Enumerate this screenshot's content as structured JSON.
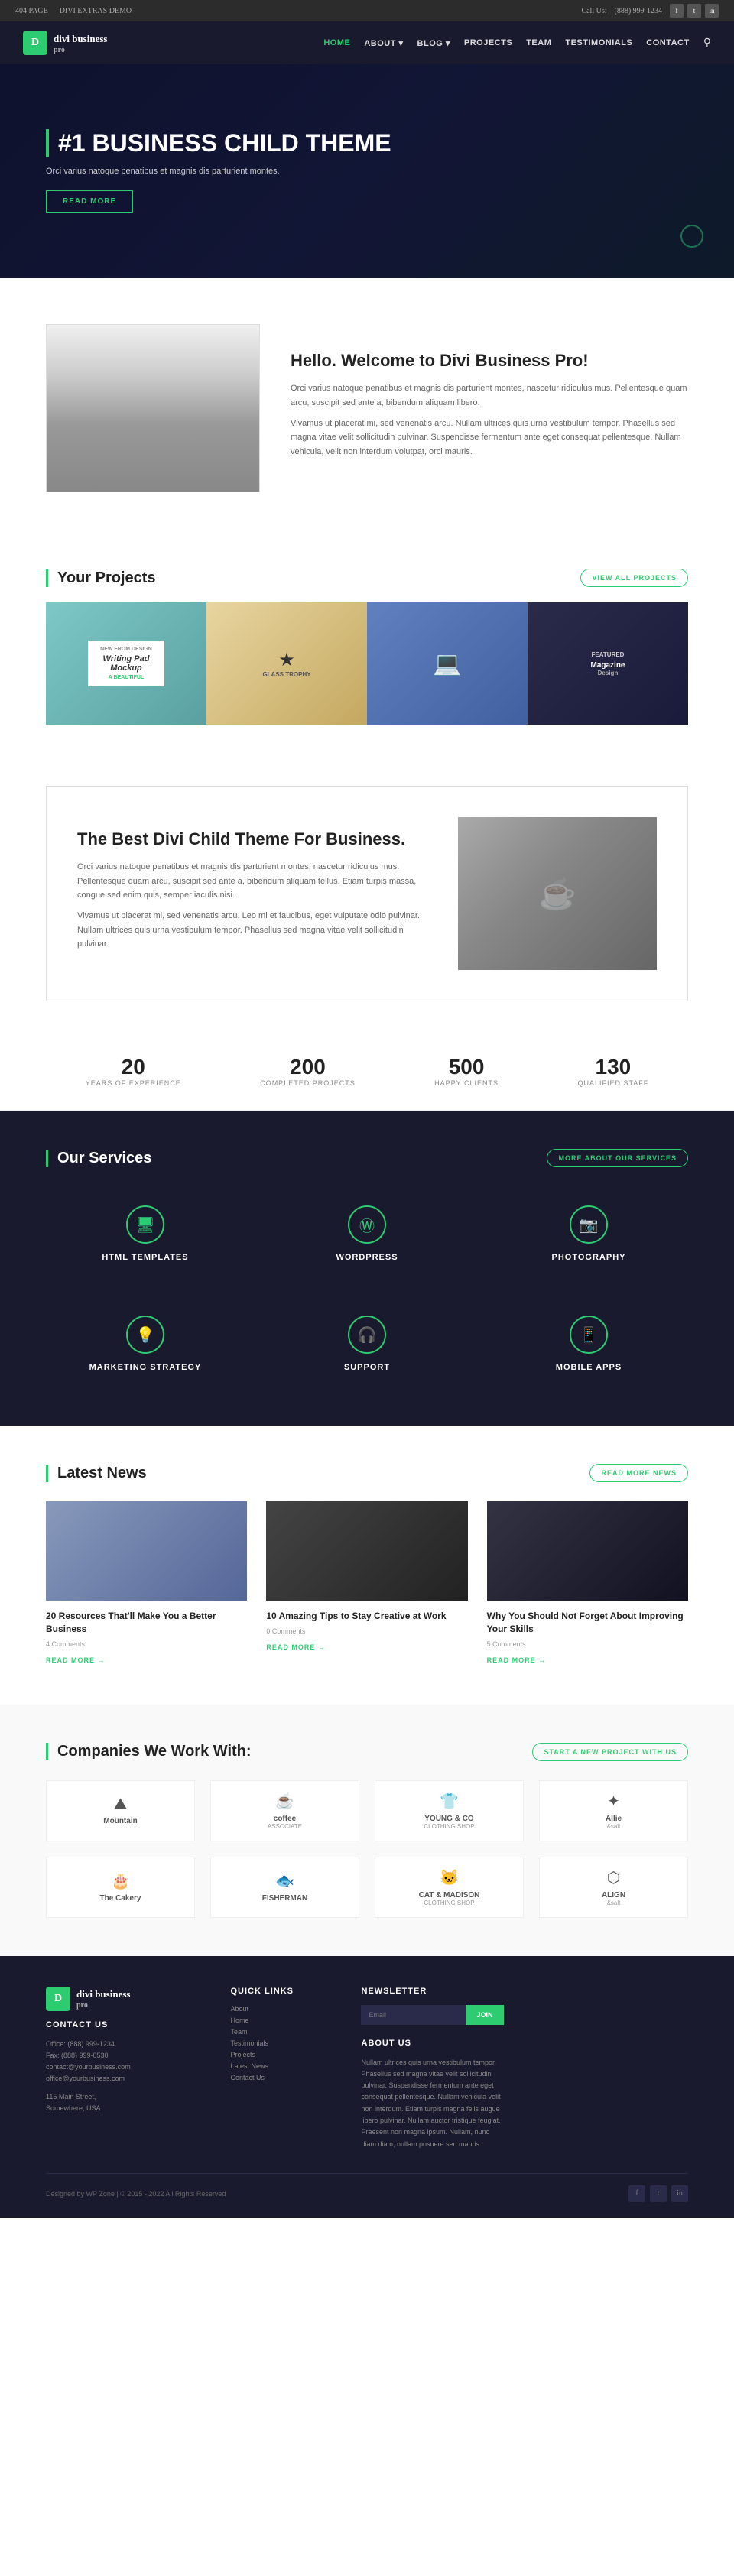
{
  "topbar": {
    "left": {
      "page": "404 PAGE",
      "extras": "DIVI EXTRAS DEMO"
    },
    "right": {
      "phone_label": "Call Us:",
      "phone": "(888) 999-1234"
    },
    "social": [
      "f",
      "t",
      "in"
    ]
  },
  "header": {
    "logo": {
      "icon": "D",
      "name": "divi business",
      "sub": "pro"
    },
    "nav": [
      {
        "label": "HOME",
        "active": true,
        "id": "home"
      },
      {
        "label": "ABOUT ▾",
        "active": false,
        "id": "about"
      },
      {
        "label": "BLOG ▾",
        "active": false,
        "id": "blog"
      },
      {
        "label": "PROJECTS",
        "active": false,
        "id": "projects"
      },
      {
        "label": "TEAM",
        "active": false,
        "id": "team"
      },
      {
        "label": "TESTIMONIALS",
        "active": false,
        "id": "testimonials"
      },
      {
        "label": "CONTACT",
        "active": false,
        "id": "contact"
      }
    ]
  },
  "hero": {
    "title": "#1 BUSINESS CHILD THEME",
    "description": "Orci varius natoque penatibus et magnis dis parturient montes.",
    "cta_label": "Read More"
  },
  "welcome": {
    "title": "Hello. Welcome to Divi Business Pro!",
    "para1": "Orci varius natoque penatibus et magnis dis parturient montes, nascetur ridiculus mus. Pellentesque quam arcu, suscipit sed ante a, bibendum aliquam libero.",
    "para2": "Vivamus ut placerat mi, sed venenatis arcu. Nullam ultrices quis urna vestibulum tempor. Phasellus sed magna vitae velit sollicitudin pulvinar. Suspendisse fermentum ante eget consequat pellentesque. Nullam vehicula, velit non interdum volutpat, orci mauris."
  },
  "projects": {
    "title": "Your Projects",
    "cta_label": "View All Projects",
    "items": [
      {
        "label": "Writing Pad Mockup"
      },
      {
        "label": "Glass Trophy"
      },
      {
        "label": "Laptop Design"
      },
      {
        "label": "Magazine Design"
      }
    ]
  },
  "best_theme": {
    "title": "The Best Divi Child Theme For Business.",
    "para1": "Orci varius natoque penatibus et magnis dis parturient montes, nascetur ridiculus mus. Pellentesque quam arcu, suscipit sed ante a, bibendum aliquam tellus. Etiam turpis massa, congue sed enim quis, semper iaculis nisi.",
    "para2": "Vivamus ut placerat mi, sed venenatis arcu. Leo mi et faucibus, eget vulputate odio pulvinar. Nullam ultrices quis urna vestibulum tempor. Phasellus sed magna vitae velit sollicitudin pulvinar."
  },
  "stats": [
    {
      "number": "20",
      "label": "YEARS OF EXPERIENCE"
    },
    {
      "number": "200",
      "label": "COMPLETED PROJECTS"
    },
    {
      "number": "500",
      "label": "HAPPY CLIENTS"
    },
    {
      "number": "130",
      "label": "QUALIFIED STAFF"
    }
  ],
  "services": {
    "title": "Our Services",
    "cta_label": "More About Our Services",
    "items": [
      {
        "icon": "🖥",
        "title": "HTML Templates"
      },
      {
        "icon": "Ⓦ",
        "title": "Wordpress"
      },
      {
        "icon": "📷",
        "title": "Photography"
      },
      {
        "icon": "💡",
        "title": "Marketing Strategy"
      },
      {
        "icon": "🎧",
        "title": "Support"
      },
      {
        "icon": "📱",
        "title": "Mobile Apps"
      }
    ]
  },
  "news": {
    "title": "Latest News",
    "cta_label": "Read More News",
    "items": [
      {
        "title": "20 Resources That'll Make You a Better Business",
        "comments": "4 Comments",
        "read_more": "READ MORE →"
      },
      {
        "title": "10 Amazing Tips to Stay Creative at Work",
        "comments": "0 Comments",
        "read_more": "READ MORE →"
      },
      {
        "title": "Why You Should Not Forget About Improving Your Skills",
        "comments": "5 Comments",
        "read_more": "READ MORE →"
      }
    ]
  },
  "companies": {
    "title": "Companies We Work With:",
    "cta_label": "Start A New Project With Us",
    "items": [
      {
        "name": "Mountain",
        "sub": ""
      },
      {
        "name": "coffee",
        "sub": "ASSOCIATE"
      },
      {
        "name": "YOUNG & CO",
        "sub": "CLOTHING SHOP"
      },
      {
        "name": "Allie",
        "sub": "&salt"
      },
      {
        "name": "The Cakery",
        "sub": ""
      },
      {
        "name": "FISHERMAN",
        "sub": ""
      },
      {
        "name": "CAT & MADISON",
        "sub": "CLOTHING SHOP"
      },
      {
        "name": "ALIGN",
        "sub": "&salt"
      }
    ]
  },
  "footer": {
    "logo": {
      "icon": "D",
      "name": "divi business",
      "sub": "pro"
    },
    "contact": {
      "title": "CONTACT US",
      "lines": [
        "Office: (888) 999-1234",
        "Fax: (888) 999-0530",
        "contact@yourbusiness.com",
        "office@yourbusiness.com",
        "",
        "115 Main Street,",
        "Somewhere, USA"
      ]
    },
    "quick_links": {
      "title": "QUICK LINKS",
      "items": [
        "About",
        "Home",
        "Team",
        "Testimonials",
        "Projects",
        "Latest News",
        "Contact Us"
      ]
    },
    "newsletter": {
      "title": "NEWSLETTER",
      "placeholder": "Email",
      "btn_label": "JOIN",
      "about_title": "ABOUT US",
      "about_text": "Nullam ultrices quis urna vestibulum tempor. Phasellus sed magna vitae velit sollicitudin pulvinar. Suspendisse fermentum ante eget consequat pellentesque. Nullam vehicula velit non interdum. Etiam turpis magna felis augue libero pulvinar. Nullam auctor tristique feugiat. Praesent non magna ipsum. Nullam, nunc diam diam, nullam posuere sed mauris."
    },
    "bottom": {
      "credit": "Designed by WP Zone | © 2015 - 2022 All Rights Reserved",
      "social": [
        "f",
        "t",
        "in"
      ]
    }
  }
}
